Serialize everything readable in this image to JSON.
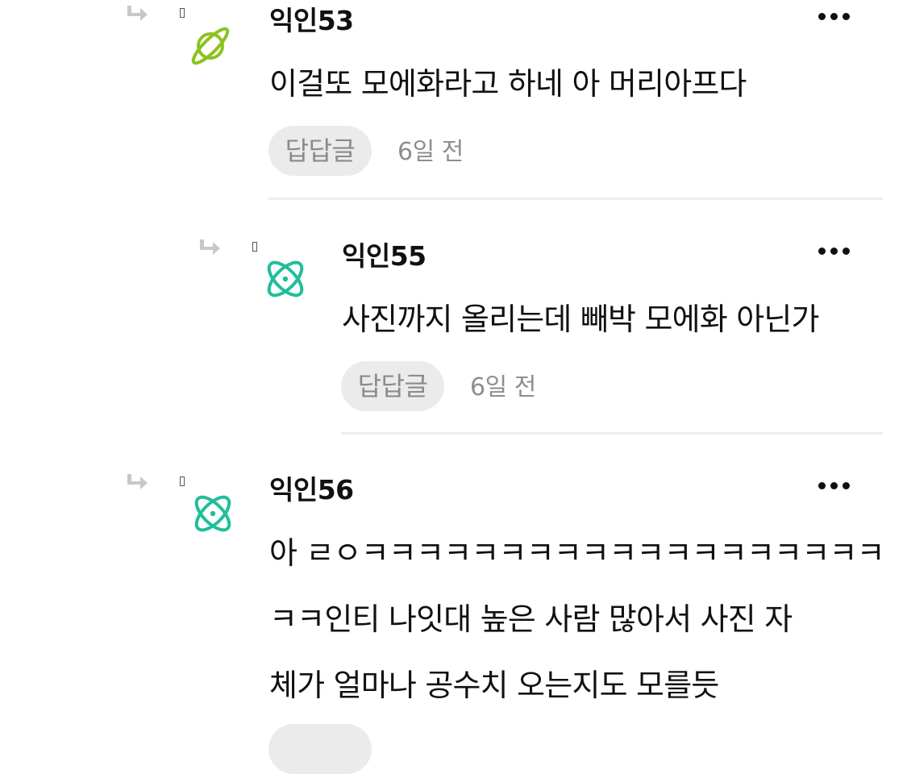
{
  "comments": [
    {
      "author": "익인53",
      "body_lines": [
        "이걸또 모에화라고 하네 아 머리아프다"
      ],
      "reply_label": "답답글",
      "time": "6일 전",
      "avatar_icon": "planet-icon",
      "avatar_color": "#8dc21f"
    },
    {
      "author": "익인55",
      "body_lines": [
        "사진까지 올리는데 빼박 모에화 아닌가"
      ],
      "reply_label": "답답글",
      "time": "6일 전",
      "avatar_icon": "atom-icon",
      "avatar_color": "#1fbf9a"
    },
    {
      "author": "익인56",
      "body_lines": [
        "아 ㄹㅇㅋㅋㅋㅋㅋㅋㅋㅋㅋㅋㅋㅋㅋㅋㅋㅋㅋㅋㅋ",
        "ㅋㅋ인티 나잇대 높은 사람 많아서 사진 자",
        "체가 얼마나 공수치 오는지도 모를듯"
      ],
      "avatar_icon": "atom-icon",
      "avatar_color": "#1fbf9a"
    }
  ],
  "icons": {
    "reply_arrow": "reply-arrow-icon",
    "more": "more-options-icon"
  },
  "colors": {
    "pill_bg": "#ebebeb",
    "muted_text": "#8b8b8b",
    "divider": "#eeeeee"
  }
}
